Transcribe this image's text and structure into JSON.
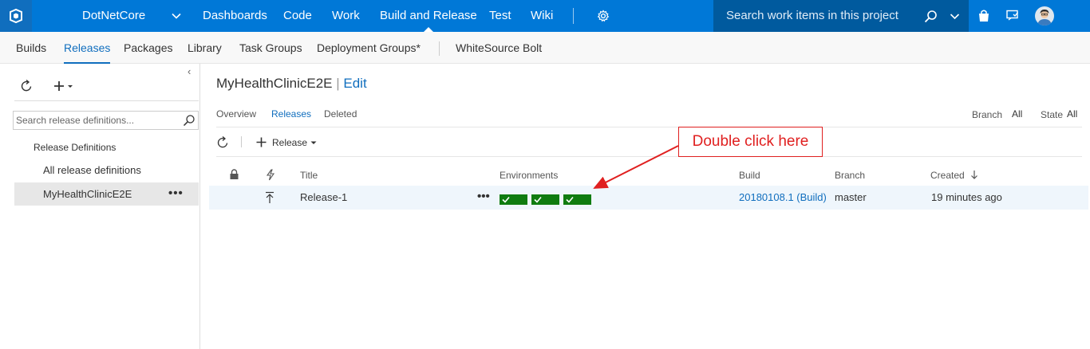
{
  "topbar": {
    "project": "DotNetCore",
    "nav": [
      "Dashboards",
      "Code",
      "Work",
      "Build and Release",
      "Test",
      "Wiki"
    ],
    "active_nav": "Build and Release",
    "search_placeholder": "Search work items in this project",
    "accent": "#0078d7"
  },
  "subnav": {
    "items": [
      "Builds",
      "Releases",
      "Packages",
      "Library",
      "Task Groups",
      "Deployment Groups*",
      "WhiteSource Bolt"
    ],
    "active": "Releases"
  },
  "left_pane": {
    "search_placeholder": "Search release definitions...",
    "group_label": "Release Definitions",
    "items": [
      "All release definitions",
      "MyHealthClinicE2E"
    ],
    "selected": "MyHealthClinicE2E",
    "more": "•••"
  },
  "main": {
    "title": "MyHealthClinicE2E",
    "title_sep": "|",
    "edit_label": "Edit",
    "tabs": [
      "Overview",
      "Releases",
      "Deleted"
    ],
    "active_tab": "Releases",
    "filters": [
      {
        "label": "Branch",
        "value": "All"
      },
      {
        "label": "State",
        "value": "All"
      }
    ],
    "toolbar": {
      "release_label": "Release"
    },
    "columns": [
      "Title",
      "Environments",
      "Build",
      "Branch",
      "Created"
    ],
    "rows": [
      {
        "title": "Release-1",
        "more": "•••",
        "environments": [
          "succeeded",
          "succeeded",
          "succeeded"
        ],
        "build": "20180108.1 (Build)",
        "branch": "master",
        "created": "19 minutes ago"
      }
    ],
    "env_color": "#107c10"
  },
  "annotation": {
    "callout": "Double click here",
    "color": "#e02020"
  }
}
